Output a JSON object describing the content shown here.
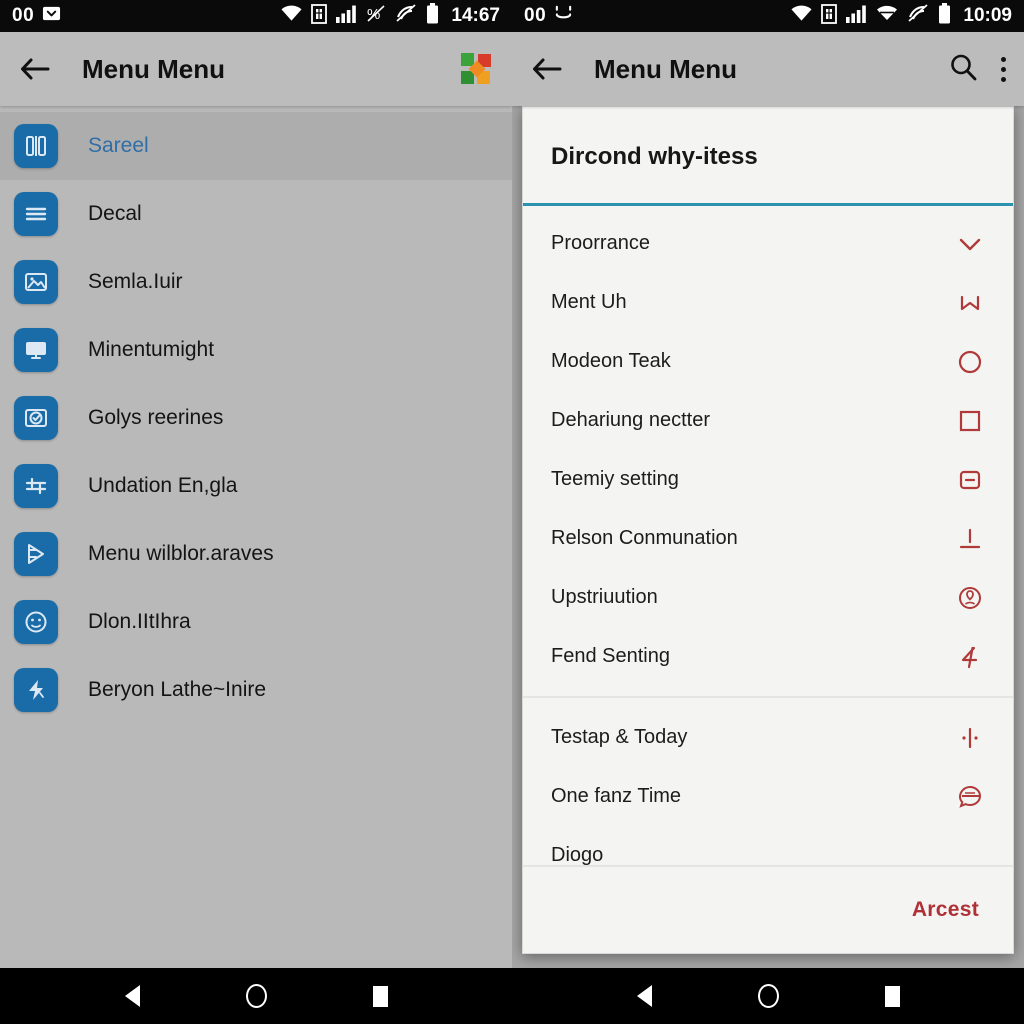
{
  "left_pane": {
    "statusbar": {
      "notif_count": "00",
      "notif_icon": "inbox-down-icon",
      "time": "14:67",
      "icons": [
        "wifi-icon",
        "sim-card-icon",
        "signal-bars-icon",
        "mute-percent-icon",
        "vibrate-slash-icon",
        "battery-icon"
      ]
    },
    "appbar": {
      "back_icon": "back-arrow-icon",
      "title": "Menu Menu",
      "logo_icon": "pinwheel-logo-icon"
    },
    "drawer_items": [
      {
        "label": "Sareel",
        "icon": "columns-icon",
        "selected": true
      },
      {
        "label": "Decal",
        "icon": "lines-list-icon",
        "selected": false
      },
      {
        "label": "Semla.Iuir",
        "icon": "image-icon",
        "selected": false
      },
      {
        "label": "Minentumight",
        "icon": "monitor-icon",
        "selected": false
      },
      {
        "label": "Golys reerines",
        "icon": "camera-check-icon",
        "selected": false
      },
      {
        "label": "Undation En,gla",
        "icon": "sliders-icon",
        "selected": false
      },
      {
        "label": "Menu wilblor.araves",
        "icon": "play-forward-icon",
        "selected": false
      },
      {
        "label": "Dlon.IItIhra",
        "icon": "face-circle-icon",
        "selected": false
      },
      {
        "label": "Beryon Lathe~Inire",
        "icon": "bolt-icon",
        "selected": false
      }
    ]
  },
  "right_pane": {
    "statusbar": {
      "notif_count": "00",
      "notif_icon": "smiley-icon",
      "time": "10:09",
      "icons": [
        "wifi-icon",
        "sim-card-icon",
        "signal-bars-icon",
        "wifi-alt-icon",
        "vibrate-slash-icon",
        "battery-icon"
      ]
    },
    "appbar": {
      "back_icon": "back-arrow-icon",
      "title": "Menu Menu",
      "search_icon": "search-icon",
      "overflow_icon": "kebab-menu-icon"
    },
    "dialog": {
      "title": "Dircond why-itess",
      "accent_color": "#2b93ad",
      "icon_color": "#b03a3a",
      "groups": [
        {
          "options": [
            {
              "label": "Proorrance",
              "icon": "chevron-down-icon"
            },
            {
              "label": "Ment Uh",
              "icon": "bookmark-icon"
            },
            {
              "label": "Modeon Teak",
              "icon": "circle-icon"
            },
            {
              "label": "Dehariung nectter",
              "icon": "square-icon"
            },
            {
              "label": "Teemiy setting",
              "icon": "minus-square-icon"
            },
            {
              "label": "Relson Conmunation",
              "icon": "underline-icon"
            },
            {
              "label": "Upstriuution",
              "icon": "location-pin-circle-icon"
            },
            {
              "label": "Fend Senting",
              "icon": "number-four-icon"
            }
          ]
        },
        {
          "options": [
            {
              "label": "Testap & Today",
              "icon": "dot-line-dot-icon"
            },
            {
              "label": "One fanz Time",
              "icon": "speech-bubble-icon"
            },
            {
              "label": "Diogo",
              "icon": "none"
            }
          ]
        }
      ],
      "action_label": "Arcest"
    }
  },
  "navbar": {
    "buttons": [
      "back-triangle-icon",
      "home-circle-icon",
      "recents-square-icon"
    ]
  }
}
